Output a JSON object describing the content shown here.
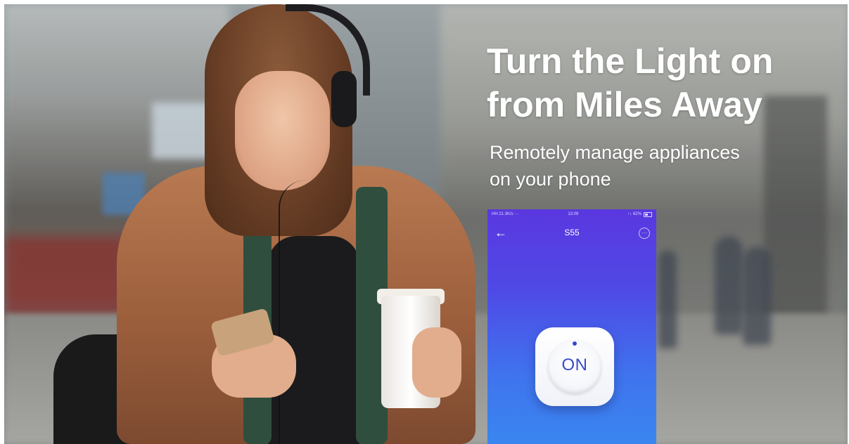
{
  "hero": {
    "headline_line1": "Turn the Light on",
    "headline_line2": "from Miles Away",
    "subhead_line1": "Remotely manage appliances",
    "subhead_line2": "on your phone"
  },
  "app": {
    "status_left": "ΗΗ 21.3K/s ···",
    "status_time": "13:09",
    "status_right": "↑↓ 62%",
    "device_name": "S55",
    "power_button_label": "ON",
    "icons": {
      "back": "back-arrow-icon",
      "more": "more-options-icon",
      "battery": "battery-icon",
      "power": "power-indicator-dot"
    },
    "gradient_colors": [
      "#5a37e0",
      "#3a86f0"
    ],
    "accent_color": "#3a4cc9"
  }
}
